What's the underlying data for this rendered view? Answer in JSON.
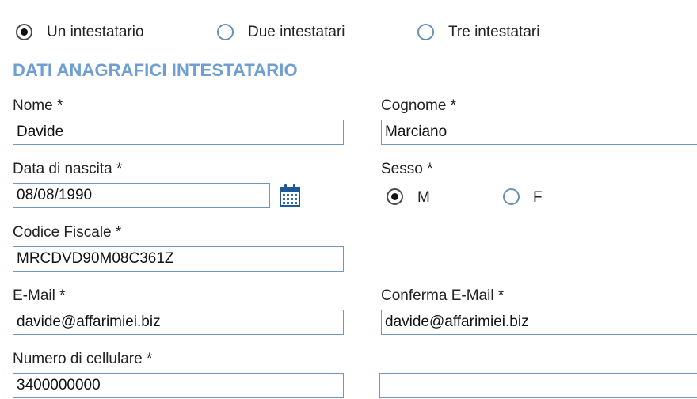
{
  "holders": {
    "options": [
      {
        "label": "Un intestatario",
        "checked": true
      },
      {
        "label": "Due intestatari",
        "checked": false
      },
      {
        "label": "Tre intestatari",
        "checked": false
      }
    ]
  },
  "section": {
    "title": "DATI ANAGRAFICI INTESTATARIO"
  },
  "fields": {
    "nome": {
      "label": "Nome *",
      "value": "Davide"
    },
    "cognome": {
      "label": "Cognome *",
      "value": "Marciano"
    },
    "data_nascita": {
      "label": "Data di nascita *",
      "value": "08/08/1990"
    },
    "sesso": {
      "label": "Sesso *",
      "options": [
        {
          "label": "M",
          "checked": true
        },
        {
          "label": "F",
          "checked": false
        }
      ]
    },
    "codice_fiscale": {
      "label": "Codice Fiscale *",
      "value": "MRCDVD90M08C361Z"
    },
    "email": {
      "label": "E-Mail *",
      "value": "davide@affarimiei.biz"
    },
    "conferma_email": {
      "label": "Conferma E-Mail *",
      "value": "davide@affarimiei.biz"
    },
    "cellulare": {
      "label": "Numero di cellulare *",
      "value": "3400000000"
    },
    "extra": {
      "value": ""
    }
  },
  "icons": {
    "calendar": "calendar-icon"
  },
  "colors": {
    "accent": "#6f9fd2",
    "field_border": "#6d96c4",
    "radio_border": "#6a8fb5"
  }
}
